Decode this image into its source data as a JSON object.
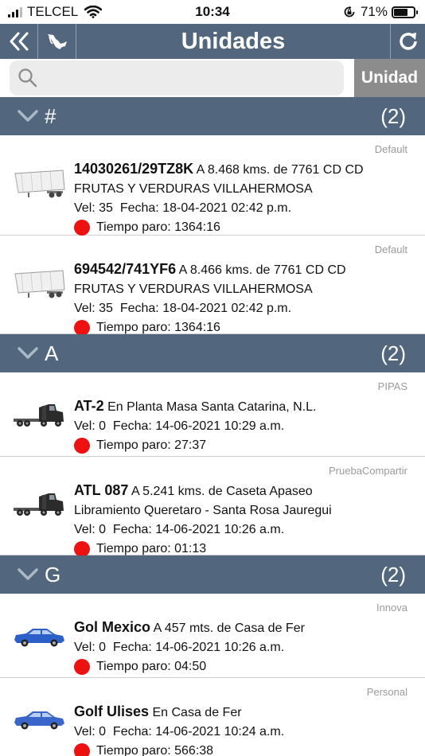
{
  "status_bar": {
    "carrier": "TELCEL",
    "time": "10:34",
    "battery": "71%",
    "battery_level": 0.71
  },
  "nav": {
    "title": "Unidades"
  },
  "search": {
    "placeholder": "",
    "value": "",
    "segment_label": "Unidad"
  },
  "sections": [
    {
      "letter": "#",
      "count": "(2)"
    },
    {
      "letter": "A",
      "count": "(2)"
    },
    {
      "letter": "G",
      "count": "(2)"
    }
  ],
  "units": [
    {
      "group": "Default",
      "name": "14030261/29TZ8K",
      "location": "A 8.468 kms. de 7761 CD CD",
      "location2": "FRUTAS Y VERDURAS VILLAHERMOSA",
      "speed": "Vel: 35",
      "date": "Fecha: 18-04-2021 02:42 p.m.",
      "stop_time": "Tiempo paro: 1364:16",
      "icon": "trailer-icon",
      "status_color": "#ee1111"
    },
    {
      "group": "Default",
      "name": "694542/741YF6",
      "location": "A 8.466 kms. de 7761 CD CD",
      "location2": "FRUTAS Y VERDURAS VILLAHERMOSA",
      "speed": "Vel: 35",
      "date": "Fecha: 18-04-2021 02:42 p.m.",
      "stop_time": "Tiempo paro: 1364:16",
      "icon": "trailer-icon",
      "status_color": "#ee1111"
    },
    {
      "group": "PIPAS",
      "name": "AT-2",
      "location": "En Planta Masa  Santa Catarina, N.L.",
      "speed": "Vel: 0",
      "date": "Fecha: 14-06-2021 10:29 a.m.",
      "stop_time": "Tiempo paro: 27:37",
      "icon": "truck-icon",
      "status_color": "#ee1111"
    },
    {
      "group": "PruebaCompartir",
      "name": "ATL 087",
      "location": "A 5.241 kms. de Caseta Apaseo",
      "location2": "Libramiento Queretaro - Santa Rosa Jauregui",
      "speed": "Vel: 0",
      "date": "Fecha: 14-06-2021 10:26 a.m.",
      "stop_time": "Tiempo paro: 01:13",
      "icon": "truck-icon",
      "status_color": "#ee1111"
    },
    {
      "group": "Innova",
      "name": "Gol Mexico",
      "location": "A 457 mts. de Casa de Fer",
      "speed": "Vel: 0",
      "date": "Fecha: 14-06-2021 10:26 a.m.",
      "stop_time": "Tiempo paro: 04:50",
      "icon": "car-icon",
      "status_color": "#ee1111"
    },
    {
      "group": "Personal",
      "name": "Golf Ulises",
      "location": "En Casa de Fer",
      "speed": "Vel: 0",
      "date": "Fecha: 14-06-2021 10:24 a.m.",
      "stop_time": "Tiempo paro: 566:38",
      "icon": "car-icon",
      "status_color": "#ee1111"
    }
  ]
}
